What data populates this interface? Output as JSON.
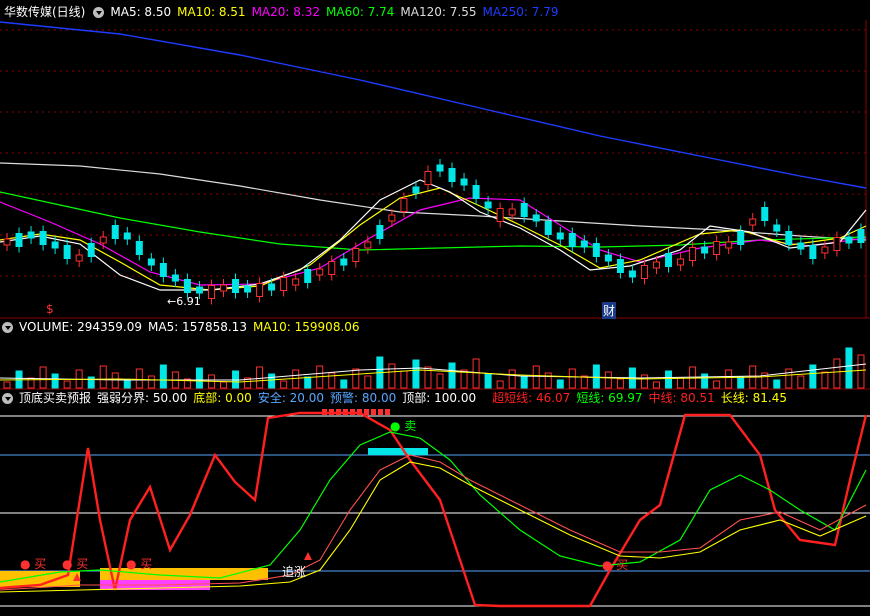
{
  "price_header": {
    "title": "华数传媒(日线)",
    "ma": [
      {
        "label": "MA5: 8.50",
        "color": "#ffffff"
      },
      {
        "label": "MA10: 8.51",
        "color": "#ffff00"
      },
      {
        "label": "MA20: 8.32",
        "color": "#ff00ff"
      },
      {
        "label": "MA60: 7.74",
        "color": "#00ff00"
      },
      {
        "label": "MA120: 7.55",
        "color": "#dcdcdc"
      },
      {
        "label": "MA250: 7.79",
        "color": "#1e3cff"
      }
    ]
  },
  "price_marks": {
    "low_label": "←6.91",
    "s_mark": "$",
    "cai_mark": "财"
  },
  "volume_header": {
    "items": [
      {
        "label": "VOLUME: 294359.09",
        "color": "#ffffff"
      },
      {
        "label": "MA5: 157858.13",
        "color": "#ffffff"
      },
      {
        "label": "MA10: 159908.06",
        "color": "#ffff00"
      }
    ]
  },
  "indicator_header": {
    "items": [
      {
        "label": "顶底买卖预报",
        "color": "#ffffff"
      },
      {
        "label": "强弱分界: 50.00",
        "color": "#ffffff"
      },
      {
        "label": "底部: 0.00",
        "color": "#ffff00"
      },
      {
        "label": "安全: 20.00",
        "color": "#57a6ff"
      },
      {
        "label": "预警: 80.00",
        "color": "#57a6ff"
      },
      {
        "label": "顶部: 100.00",
        "color": "#ffffff"
      },
      {
        "label": "超短线: 46.07",
        "color": "#ff2020"
      },
      {
        "label": "短线: 69.97",
        "color": "#00ff00"
      },
      {
        "label": "中线: 80.51",
        "color": "#ff2020"
      },
      {
        "label": "长线: 81.45",
        "color": "#ffff00"
      }
    ]
  },
  "indicator_marks": {
    "buy_label": "买",
    "sell_label": "卖",
    "chase_label": "追涨"
  },
  "colors": {
    "up": "#ff3030",
    "down": "#00e5e5",
    "grid": "#8a0000",
    "bg": "#000000"
  }
}
